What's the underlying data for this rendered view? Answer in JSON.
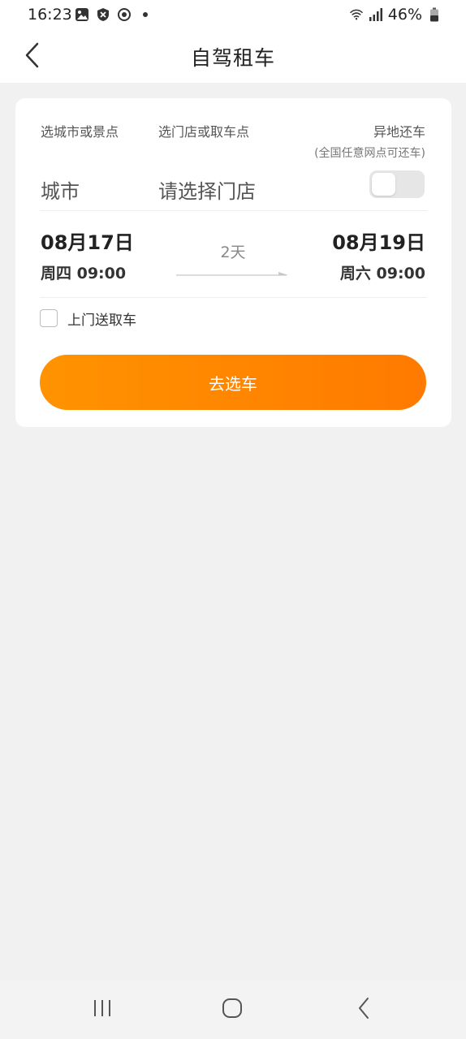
{
  "status_bar": {
    "time": "16:23",
    "battery": "46%",
    "icons": [
      "image-icon",
      "shield-icon",
      "sync-icon",
      "dot-icon",
      "wifi-icon",
      "signal-icon",
      "battery-icon"
    ]
  },
  "header": {
    "title": "自驾租车",
    "back_icon": "chevron-left-icon"
  },
  "form": {
    "city_hint": "选城市或景点",
    "store_hint": "选门店或取车点",
    "return_label": "异地还车",
    "return_note": "(全国任意网点可还车)",
    "city_value": "城市",
    "store_placeholder": "请选择门店",
    "return_toggle_on": false
  },
  "dates": {
    "pickup_date": "08月17日",
    "pickup_time": "周四 09:00",
    "duration": "2天",
    "return_date": "08月19日",
    "return_time": "周六 09:00"
  },
  "delivery": {
    "label": "上门送取车",
    "checked": false
  },
  "action": {
    "button_label": "去选车",
    "colors": {
      "start": "#ff9300",
      "end": "#ff7a00"
    }
  },
  "nav_bar": {
    "icons": [
      "recent-apps-icon",
      "home-icon",
      "back-icon"
    ]
  }
}
